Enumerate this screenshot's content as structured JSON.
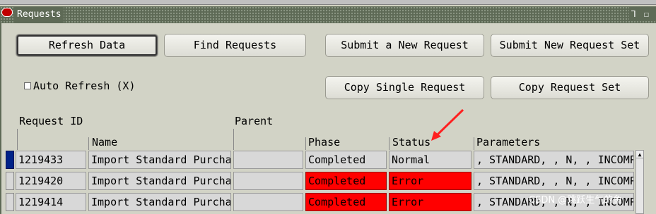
{
  "window": {
    "title": "Requests",
    "controls": "⅂ ☐ ✕"
  },
  "buttons": {
    "refresh": "Refresh Data",
    "find": "Find Requests",
    "submit_new": "Submit a New Request",
    "submit_set": "Submit New Request Set",
    "copy_single": "Copy Single Request",
    "copy_set": "Copy Request Set"
  },
  "auto_refresh": {
    "label": "Auto Refresh (X)",
    "checked": false
  },
  "columns": {
    "request_id": "Request ID",
    "parent": "Parent",
    "name": "Name",
    "phase": "Phase",
    "status": "Status",
    "parameters": "Parameters"
  },
  "rows": [
    {
      "id": "1219433",
      "name": "Import Standard Purcha",
      "parent": "",
      "phase": "Completed",
      "status": "Normal",
      "params": ", STANDARD, , N, , INCOMPLETE",
      "error": false
    },
    {
      "id": "1219420",
      "name": "Import Standard Purcha",
      "parent": "",
      "phase": "Completed",
      "status": "Error",
      "params": ", STANDARD, , N, , INCOMPLETE",
      "error": true
    },
    {
      "id": "1219414",
      "name": "Import Standard Purcha",
      "parent": "",
      "phase": "Completed",
      "status": "Error",
      "params": ", STANDARD, , N, , INCOMPLETE",
      "error": true
    }
  ],
  "watermark": "CSDN @跳跃生气的鱼",
  "colors": {
    "titlebar": "#5e6a56",
    "error": "#ff0000",
    "selected": "#002288"
  }
}
